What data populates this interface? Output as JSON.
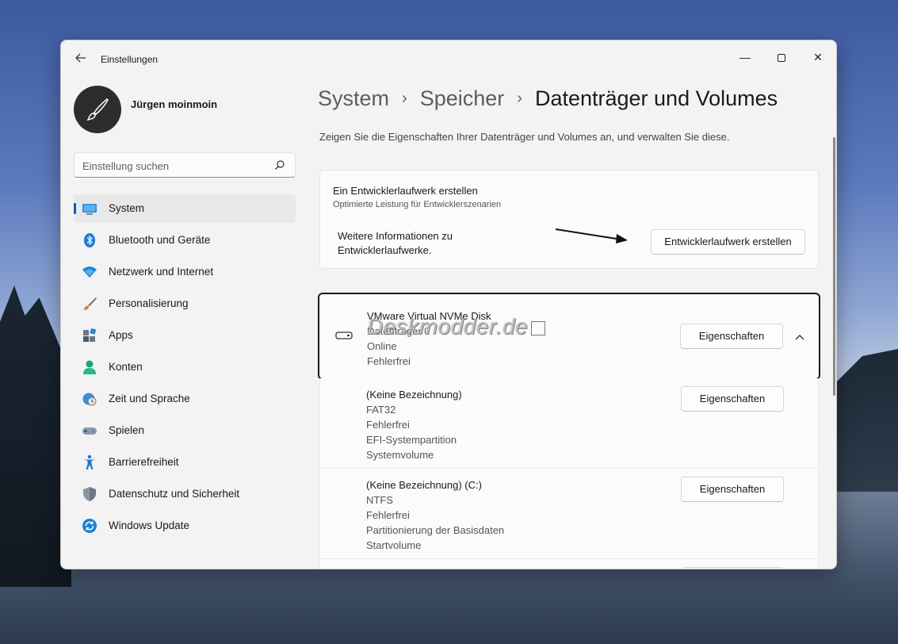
{
  "window": {
    "title": "Einstellungen",
    "minimize": "—",
    "close": "✕"
  },
  "user": {
    "name": "Jürgen moinmoin"
  },
  "search": {
    "placeholder": "Einstellung suchen"
  },
  "nav": [
    {
      "label": "System",
      "icon": "system-icon",
      "active": true
    },
    {
      "label": "Bluetooth und Geräte",
      "icon": "bluetooth-icon"
    },
    {
      "label": "Netzwerk und Internet",
      "icon": "wifi-icon"
    },
    {
      "label": "Personalisierung",
      "icon": "brush-icon"
    },
    {
      "label": "Apps",
      "icon": "apps-icon"
    },
    {
      "label": "Konten",
      "icon": "person-icon"
    },
    {
      "label": "Zeit und Sprache",
      "icon": "clock-globe-icon"
    },
    {
      "label": "Spielen",
      "icon": "gamepad-icon"
    },
    {
      "label": "Barrierefreiheit",
      "icon": "accessibility-icon"
    },
    {
      "label": "Datenschutz und Sicherheit",
      "icon": "shield-icon"
    },
    {
      "label": "Windows Update",
      "icon": "update-icon"
    }
  ],
  "breadcrumb": {
    "part1": "System",
    "part2": "Speicher",
    "current": "Datenträger und Volumes",
    "separator": "›"
  },
  "description": "Zeigen Sie die Eigenschaften Ihrer Datenträger und Volumes an, und verwalten Sie diese.",
  "dev_drive": {
    "title": "Ein Entwicklerlaufwerk erstellen",
    "subtitle": "Optimierte Leistung für Entwicklerszenarien",
    "link_text": "Weitere Informationen zu Entwicklerlaufwerke.",
    "button": "Entwicklerlaufwerk erstellen"
  },
  "disk": {
    "name": "VMware Virtual NVMe Disk",
    "number": "Datenträger 0",
    "status": "Online",
    "health": "Fehlerfrei",
    "button": "Eigenschaften",
    "watermark": "Deskmodder.de"
  },
  "volumes": [
    {
      "lines": [
        "(Keine Bezeichnung)",
        "FAT32",
        "Fehlerfrei",
        "EFI-Systempartition",
        "Systemvolume"
      ],
      "button": "Eigenschaften"
    },
    {
      "lines": [
        "(Keine Bezeichnung) (C:)",
        "NTFS",
        "Fehlerfrei",
        "Partitionierung der Basisdaten",
        "Startvolume"
      ],
      "button": "Eigenschaften"
    }
  ],
  "colors": {
    "accent": "#005fb8",
    "background": "#f3f3f3",
    "card": "#fbfbfb"
  }
}
